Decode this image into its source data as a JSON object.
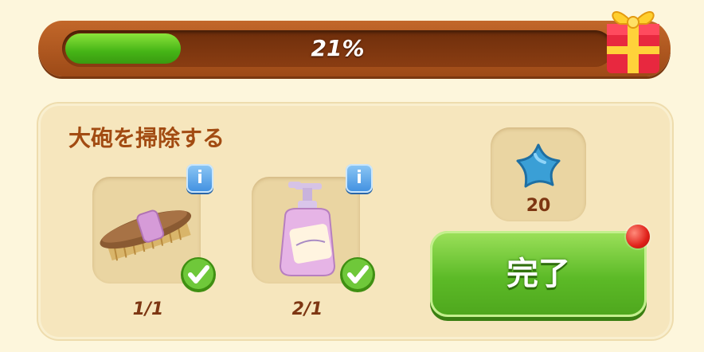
{
  "progress": {
    "percent_label": "21%",
    "value": 0.21
  },
  "task": {
    "title": "大砲を掃除する",
    "items": [
      {
        "name": "brush",
        "count": "1/1",
        "info": "i",
        "completed": true
      },
      {
        "name": "soap-bottle",
        "count": "2/1",
        "info": "i",
        "completed": true
      }
    ]
  },
  "reward": {
    "icon": "blue-star",
    "amount": "20"
  },
  "done_button": {
    "label": "完了"
  },
  "colors": {
    "accent_green": "#5cba27",
    "frame_brown": "#b35c22",
    "text_brown": "#7d3612",
    "notification_red": "#e0211a"
  }
}
